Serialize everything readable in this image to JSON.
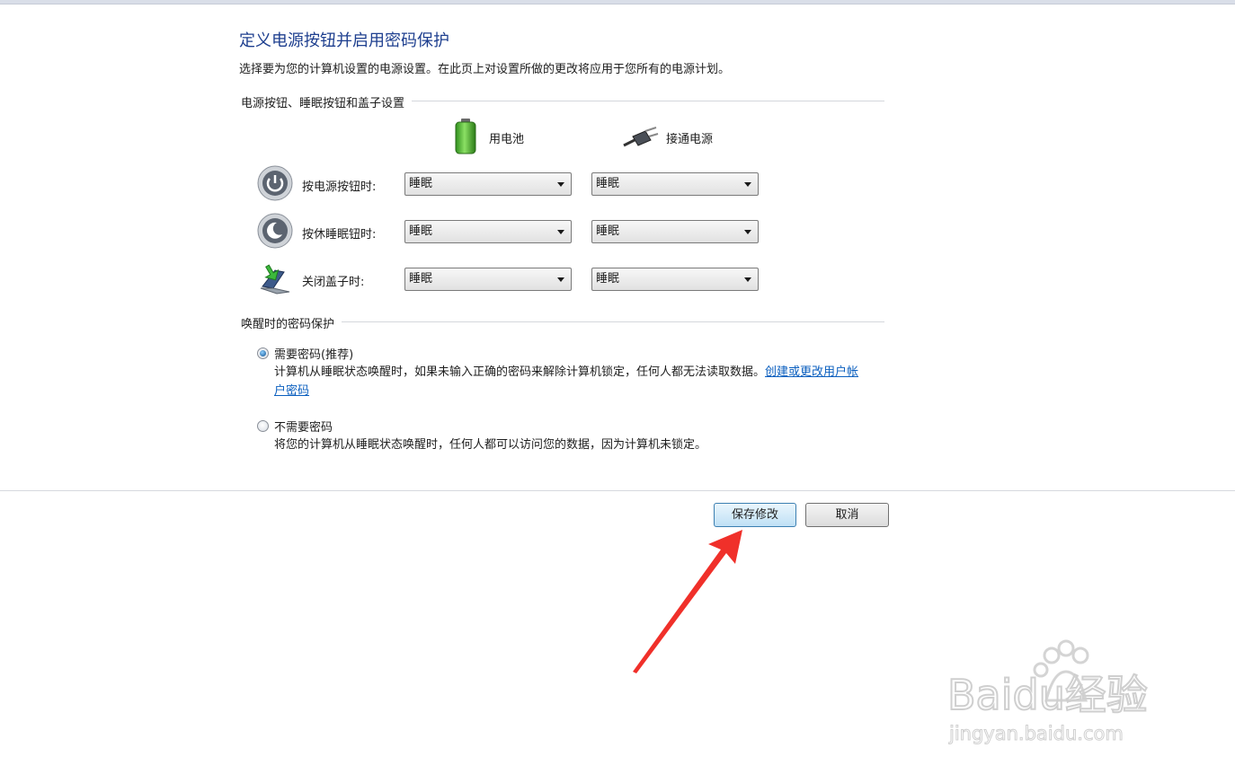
{
  "page": {
    "title": "定义电源按钮并启用密码保护",
    "subtitle": "选择要为您的计算机设置的电源设置。在此页上对设置所做的更改将应用于您所有的电源计划。"
  },
  "buttons_section": {
    "header": "电源按钮、睡眠按钮和盖子设置",
    "col_battery": "用电池",
    "col_plugged": "接通电源",
    "rows": [
      {
        "label": "按电源按钮时:",
        "battery": "睡眠",
        "plugged": "睡眠",
        "icon": "power-button-icon"
      },
      {
        "label": "按休睡眠钮时:",
        "battery": "睡眠",
        "plugged": "睡眠",
        "icon": "sleep-button-icon"
      },
      {
        "label": "关闭盖子时:",
        "battery": "睡眠",
        "plugged": "睡眠",
        "icon": "laptop-lid-icon"
      }
    ]
  },
  "wake_section": {
    "header": "唤醒时的密码保护",
    "require": {
      "label": "需要密码(推荐)",
      "desc": "计算机从睡眠状态唤醒时，如果未输入正确的密码来解除计算机锁定，任何人都无法读取数据。",
      "link": "创建或更改用户帐户密码",
      "checked": true
    },
    "no_require": {
      "label": "不需要密码",
      "desc": "将您的计算机从睡眠状态唤醒时，任何人都可以访问您的数据，因为计算机未锁定。",
      "checked": false
    }
  },
  "footer": {
    "save": "保存修改",
    "cancel": "取消"
  },
  "watermark": {
    "brand": "Baidu经验",
    "url": "jingyan.baidu.com"
  },
  "colors": {
    "title": "#1e3f8f",
    "link": "#0b5fbf",
    "annotation_arrow": "#f0302a"
  }
}
